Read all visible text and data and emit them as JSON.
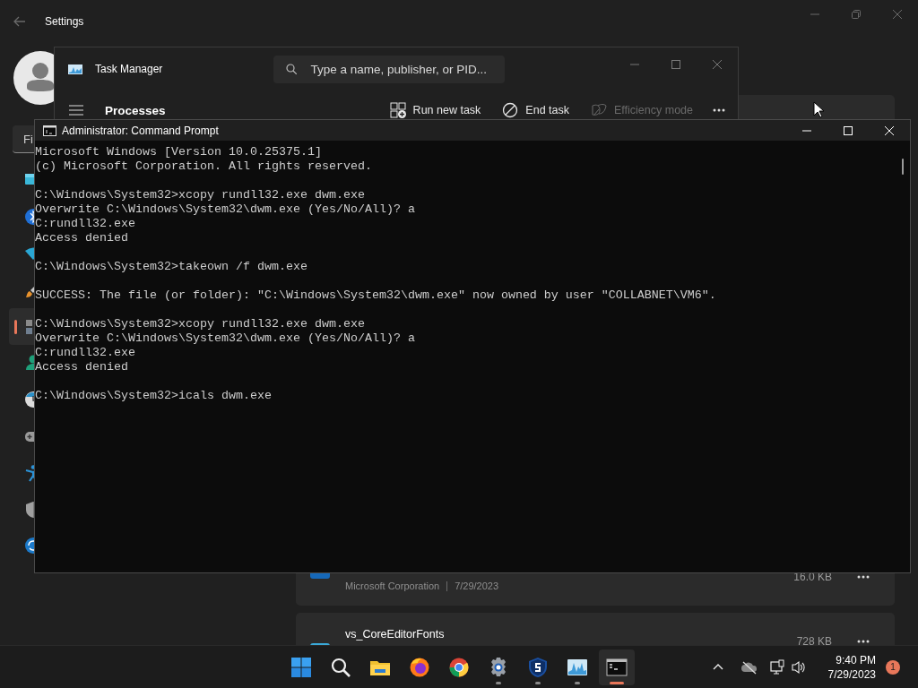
{
  "settings_window": {
    "title": "Settings",
    "search": {
      "placeholder": "Fi"
    },
    "nav_items": [
      {
        "kind": "display",
        "selected": false
      },
      {
        "kind": "bluetooth",
        "selected": false
      },
      {
        "kind": "network",
        "selected": false
      },
      {
        "kind": "personalization",
        "selected": false
      },
      {
        "kind": "apps",
        "selected": true
      },
      {
        "kind": "accounts",
        "selected": false
      },
      {
        "kind": "time",
        "selected": false
      },
      {
        "kind": "gaming",
        "selected": false
      },
      {
        "kind": "accessibility",
        "selected": false
      },
      {
        "kind": "privacy",
        "selected": false
      },
      {
        "kind": "update",
        "selected": false
      }
    ],
    "app_list": [
      {
        "kind": "header"
      },
      {
        "kind": "app",
        "publisher": "Microsoft Corporation",
        "date": "7/29/2023",
        "size": "16.0 KB"
      },
      {
        "kind": "app",
        "name": "vs_CoreEditorFonts",
        "size": "728 KB"
      }
    ]
  },
  "task_manager": {
    "title": "Task Manager",
    "search": {
      "placeholder": "Type a name, publisher, or PID..."
    },
    "page_title": "Processes",
    "actions": [
      {
        "kind": "run",
        "label": "Run new task",
        "disabled": false
      },
      {
        "kind": "end",
        "label": "End task",
        "disabled": false
      },
      {
        "kind": "efficiency",
        "label": "Efficiency mode",
        "disabled": true
      }
    ]
  },
  "command_prompt": {
    "title": "Administrator: Command Prompt",
    "blocks": [
      [
        "Microsoft Windows [Version 10.0.25375.1]",
        "(c) Microsoft Corporation. All rights reserved."
      ],
      [
        "C:\\Windows\\System32>xcopy rundll32.exe dwm.exe",
        "Overwrite C:\\Windows\\System32\\dwm.exe (Yes/No/All)? a",
        "C:rundll32.exe",
        "Access denied"
      ],
      [
        "C:\\Windows\\System32>takeown /f dwm.exe"
      ],
      [
        "SUCCESS: The file (or folder): \"C:\\Windows\\System32\\dwm.exe\" now owned by user \"COLLABNET\\VM6\"."
      ],
      [
        "C:\\Windows\\System32>xcopy rundll32.exe dwm.exe",
        "Overwrite C:\\Windows\\System32\\dwm.exe (Yes/No/All)? a",
        "C:rundll32.exe",
        "Access denied"
      ],
      [
        "C:\\Windows\\System32>icals dwm.exe"
      ]
    ]
  },
  "taskbar": {
    "apps": [
      {
        "kind": "start",
        "running": false,
        "selected": false
      },
      {
        "kind": "search",
        "running": false,
        "selected": false
      },
      {
        "kind": "explorer",
        "running": false,
        "selected": false
      },
      {
        "kind": "firefox",
        "running": false,
        "selected": false
      },
      {
        "kind": "chrome",
        "running": false,
        "selected": false
      },
      {
        "kind": "settings",
        "running": true,
        "selected": false
      },
      {
        "kind": "shield",
        "running": true,
        "selected": false
      },
      {
        "kind": "taskmanager",
        "running": true,
        "selected": false
      },
      {
        "kind": "terminal",
        "running": true,
        "selected": true
      }
    ],
    "time": "9:40 PM",
    "date": "7/29/2023",
    "notifications": "1"
  }
}
